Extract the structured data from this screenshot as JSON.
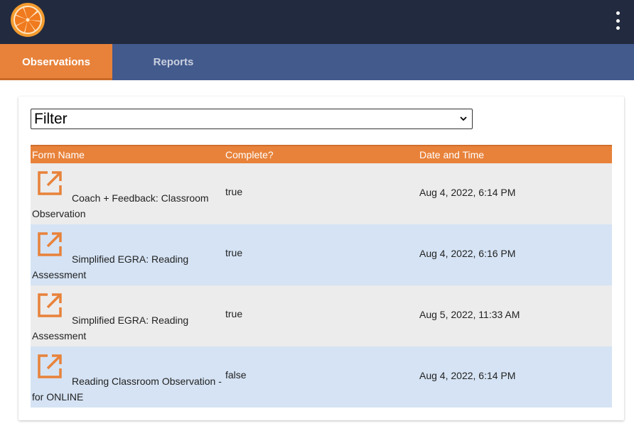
{
  "colors": {
    "topbar": "#222a3f",
    "tabbar": "#435a8d",
    "accent": "#e8823a",
    "row_odd": "#ececec",
    "row_even": "#d5e3f4"
  },
  "header": {
    "logo_icon": "orange-slice-logo",
    "menu_icon": "kebab-menu-icon"
  },
  "tabs": [
    {
      "label": "Observations",
      "active": true
    },
    {
      "label": "Reports",
      "active": false
    }
  ],
  "filter": {
    "selected": "Filter"
  },
  "table": {
    "columns": [
      "Form Name",
      "Complete?",
      "Date and Time"
    ],
    "rows": [
      {
        "icon": "open-external-icon",
        "form_name": "Coach + Feedback: Classroom Observation",
        "complete": "true",
        "date": "Aug 4, 2022, 6:14 PM"
      },
      {
        "icon": "open-external-icon",
        "form_name": "Simplified EGRA: Reading Assessment",
        "complete": "true",
        "date": "Aug 4, 2022, 6:16 PM"
      },
      {
        "icon": "open-external-icon",
        "form_name": "Simplified EGRA: Reading Assessment",
        "complete": "true",
        "date": "Aug 5, 2022, 11:33 AM"
      },
      {
        "icon": "open-external-icon",
        "form_name": "Reading Classroom Observation - for ONLINE",
        "complete": "false",
        "date": "Aug 4, 2022, 6:14 PM"
      }
    ]
  }
}
